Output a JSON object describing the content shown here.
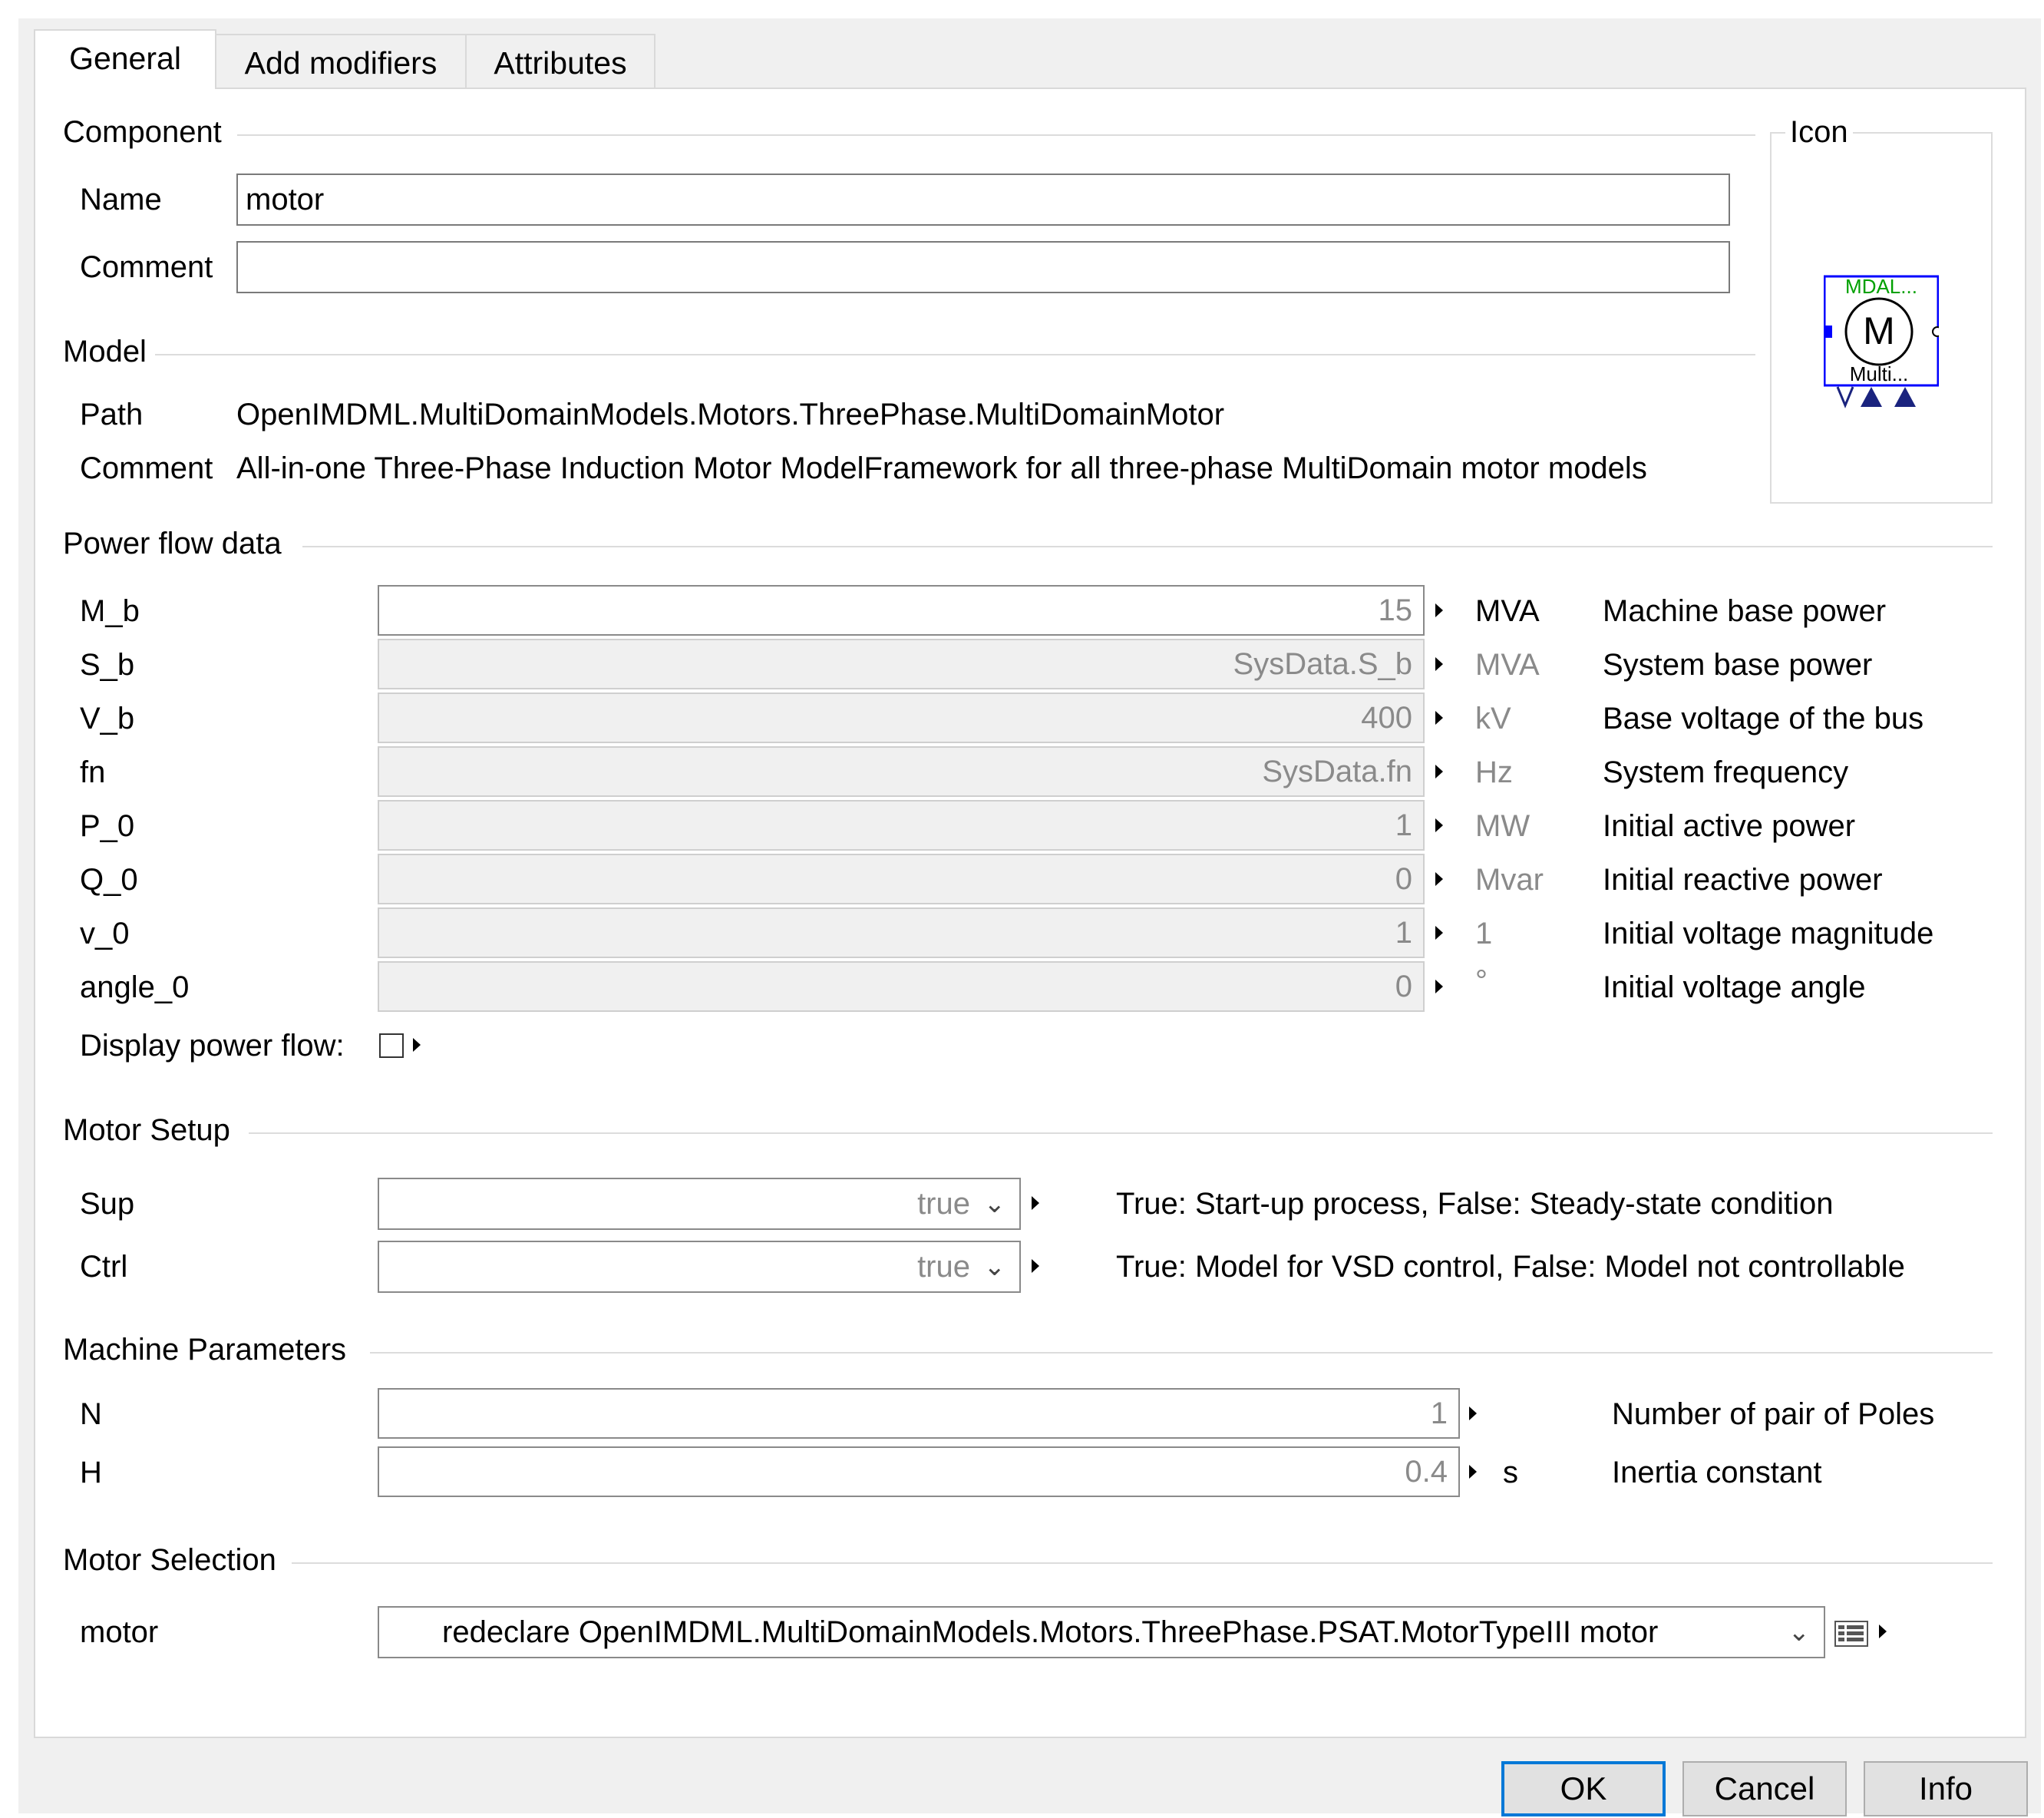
{
  "tabs": [
    {
      "label": "General"
    },
    {
      "label": "Add modifiers"
    },
    {
      "label": "Attributes"
    }
  ],
  "component": {
    "section_title": "Component",
    "name_label": "Name",
    "name_value": "motor",
    "comment_label": "Comment",
    "comment_value": ""
  },
  "icon": {
    "section_title": "Icon",
    "top_text": "MDAL...",
    "letter": "M",
    "bottom_text": "Multi..."
  },
  "model": {
    "section_title": "Model",
    "path_label": "Path",
    "path_value": "OpenIMDML.MultiDomainModels.Motors.ThreePhase.MultiDomainMotor",
    "comment_label": "Comment",
    "comment_value": "All-in-one Three-Phase Induction Motor ModelFramework for all three-phase MultiDomain motor models"
  },
  "power_flow": {
    "section_title": "Power flow data",
    "rows": [
      {
        "name": "M_b",
        "value": "15",
        "unit": "MVA",
        "desc": "Machine base power"
      },
      {
        "name": "S_b",
        "value": "SysData.S_b",
        "unit": "MVA",
        "desc": "System base power"
      },
      {
        "name": "V_b",
        "value": "400",
        "unit": "kV",
        "desc": "Base voltage of the bus"
      },
      {
        "name": "fn",
        "value": "SysData.fn",
        "unit": "Hz",
        "desc": "System frequency"
      },
      {
        "name": "P_0",
        "value": "1",
        "unit": "MW",
        "desc": "Initial active power"
      },
      {
        "name": "Q_0",
        "value": "0",
        "unit": "Mvar",
        "desc": "Initial reactive power"
      },
      {
        "name": "v_0",
        "value": "1",
        "unit": "1",
        "desc": "Initial voltage magnitude"
      },
      {
        "name": "angle_0",
        "value": "0",
        "unit": "°",
        "desc": "Initial voltage angle"
      }
    ],
    "display_label": "Display power flow:",
    "display_checked": false
  },
  "motor_setup": {
    "section_title": "Motor Setup",
    "rows": [
      {
        "name": "Sup",
        "value": "true",
        "desc": "True: Start-up process, False: Steady-state condition"
      },
      {
        "name": "Ctrl",
        "value": "true",
        "desc": "True: Model for VSD control, False: Model not controllable"
      }
    ]
  },
  "machine_params": {
    "section_title": "Machine Parameters",
    "rows": [
      {
        "name": "N",
        "value": "1",
        "unit": "",
        "desc": "Number of pair of Poles"
      },
      {
        "name": "H",
        "value": "0.4",
        "unit": "s",
        "desc": "Inertia constant"
      }
    ]
  },
  "motor_selection": {
    "section_title": "Motor Selection",
    "label": "motor",
    "value": "redeclare OpenIMDML.MultiDomainModels.Motors.ThreePhase.PSAT.MotorTypeIII motor"
  },
  "buttons": {
    "ok": "OK",
    "cancel": "Cancel",
    "info": "Info"
  },
  "colors": {
    "focus_blue": "#0078d7",
    "icon_blue": "#0000ff",
    "icon_green": "#00a000",
    "icon_navy": "#1a237e"
  }
}
